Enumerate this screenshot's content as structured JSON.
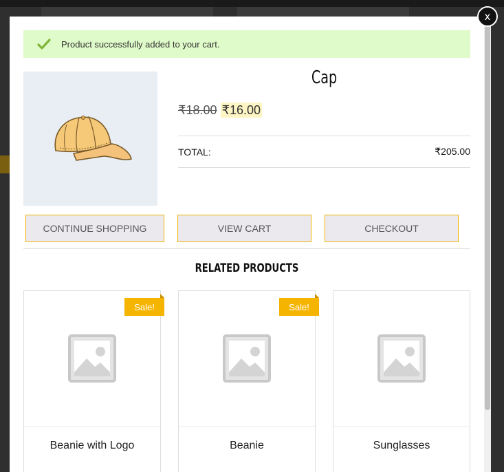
{
  "notice": {
    "message": "Product successfully added to your cart."
  },
  "close": {
    "label": "x"
  },
  "product": {
    "title": "Cap",
    "price_old": "₹18.00",
    "price_new": "₹16.00",
    "total_label": "TOTAL:",
    "total_value": "₹205.00"
  },
  "actions": {
    "continue_label": "CONTINUE SHOPPING",
    "view_cart_label": "VIEW CART",
    "checkout_label": "CHECKOUT"
  },
  "related": {
    "title": "RELATED PRODUCTS",
    "items": [
      {
        "name": "Beanie with Logo",
        "badge": "Sale!"
      },
      {
        "name": "Beanie",
        "badge": "Sale!"
      },
      {
        "name": "Sunglasses"
      }
    ]
  },
  "colors": {
    "accent": "#f5b400",
    "notice_bg": "#dffbc9",
    "check": "#7fb536"
  }
}
